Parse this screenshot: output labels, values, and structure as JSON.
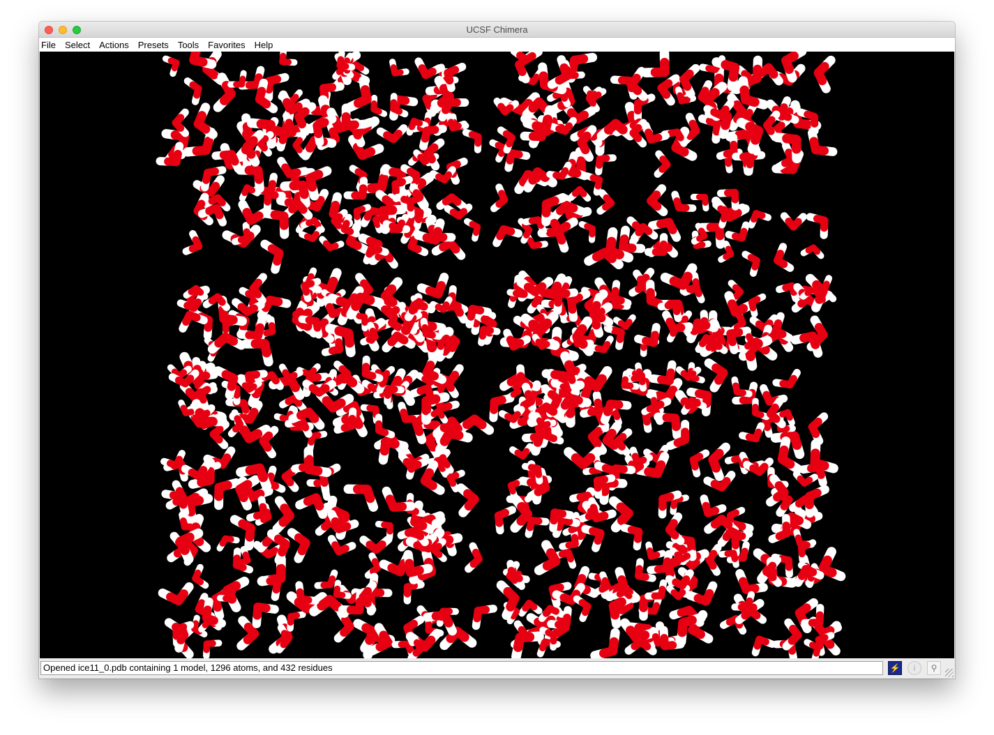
{
  "window": {
    "title": "UCSF Chimera"
  },
  "menubar": {
    "items": [
      {
        "label": "File"
      },
      {
        "label": "Select"
      },
      {
        "label": "Actions"
      },
      {
        "label": "Presets"
      },
      {
        "label": "Tools"
      },
      {
        "label": "Favorites"
      },
      {
        "label": "Help"
      }
    ]
  },
  "viewer": {
    "background_color": "#000000",
    "oxygen_color": "#e60012",
    "hydrogen_color": "#ffffff",
    "model": "ice11_0.pdb"
  },
  "statusbar": {
    "message": "Opened ice11_0.pdb containing 1 model, 1296 atoms, and 432 residues",
    "icons": [
      "lightning-icon",
      "info-icon",
      "magnifier-icon"
    ]
  }
}
